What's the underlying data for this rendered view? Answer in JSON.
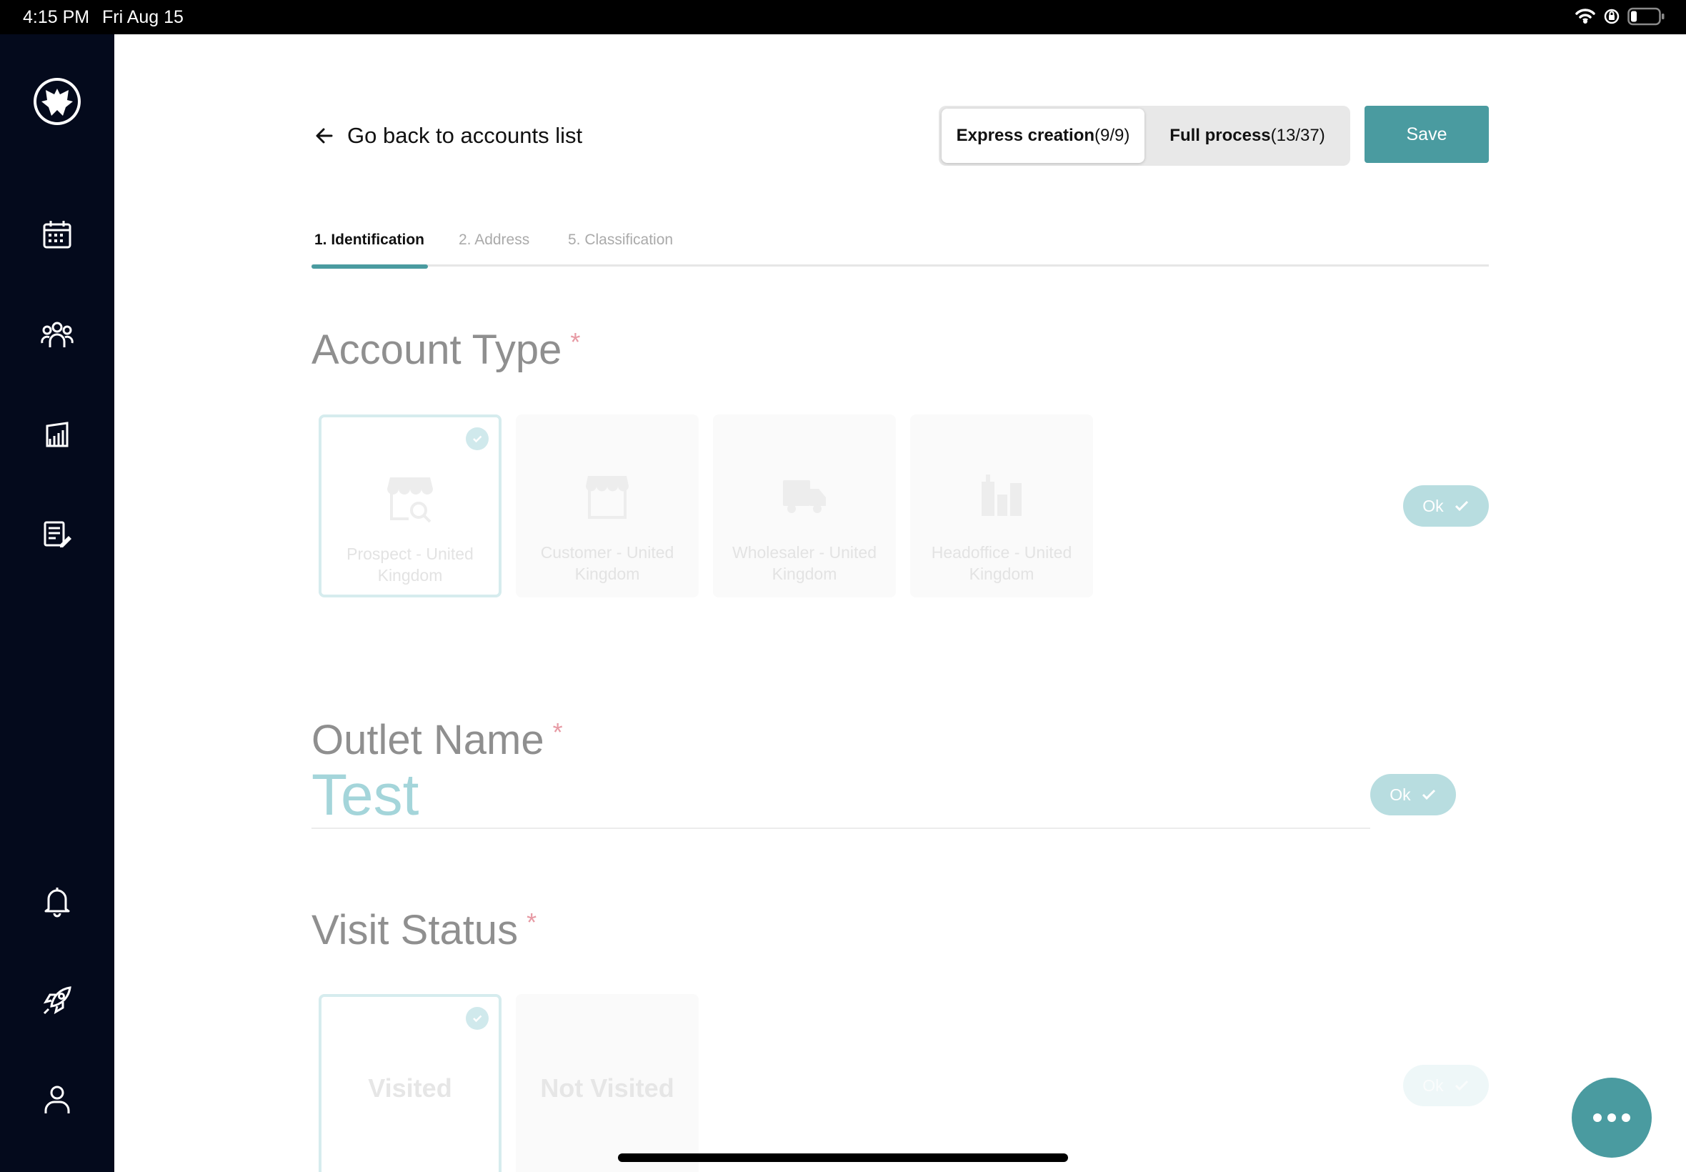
{
  "status_bar": {
    "time": "4:15 PM",
    "date": "Fri Aug 15"
  },
  "sidebar": {
    "items": [
      {
        "name": "logo",
        "icon": "bat-logo-icon"
      },
      {
        "name": "calendar",
        "icon": "calendar-icon"
      },
      {
        "name": "accounts",
        "icon": "users-icon"
      },
      {
        "name": "reports",
        "icon": "bar-chart-icon"
      },
      {
        "name": "notes",
        "icon": "edit-document-icon"
      },
      {
        "name": "notifications",
        "icon": "bell-icon"
      },
      {
        "name": "launch",
        "icon": "rocket-icon"
      },
      {
        "name": "profile",
        "icon": "person-icon"
      }
    ]
  },
  "header": {
    "back_label": "Go back to accounts list",
    "segments": [
      {
        "label": "Express creation",
        "count": "(9/9)",
        "active": true
      },
      {
        "label": "Full process",
        "count": "(13/37)",
        "active": false
      }
    ],
    "save_label": "Save"
  },
  "tabs": [
    {
      "label": "1. Identification",
      "active": true
    },
    {
      "label": "2. Address",
      "active": false
    },
    {
      "label": "5. Classification",
      "active": false
    }
  ],
  "account_type": {
    "title": "Account Type",
    "required_mark": "*",
    "options": [
      {
        "label": "Prospect - United Kingdom",
        "icon": "store-search-icon",
        "selected": true
      },
      {
        "label": "Customer - United Kingdom",
        "icon": "store-icon",
        "selected": false
      },
      {
        "label": "Wholesaler - United Kingdom",
        "icon": "delivery-truck-icon",
        "selected": false
      },
      {
        "label": "Headoffice - United Kingdom",
        "icon": "office-buildings-icon",
        "selected": false
      }
    ],
    "ok_label": "Ok"
  },
  "outlet_name": {
    "title": "Outlet Name",
    "required_mark": "*",
    "value": "Test",
    "ok_label": "Ok"
  },
  "visit_status": {
    "title": "Visit Status",
    "required_mark": "*",
    "options": [
      {
        "label": "Visited",
        "selected": true
      },
      {
        "label": "Not Visited",
        "selected": false
      }
    ],
    "ok_label": "Ok"
  },
  "colors": {
    "accent": "#4a9ba0",
    "sidebar_bg": "#040a1c",
    "required": "#e79aa4"
  }
}
